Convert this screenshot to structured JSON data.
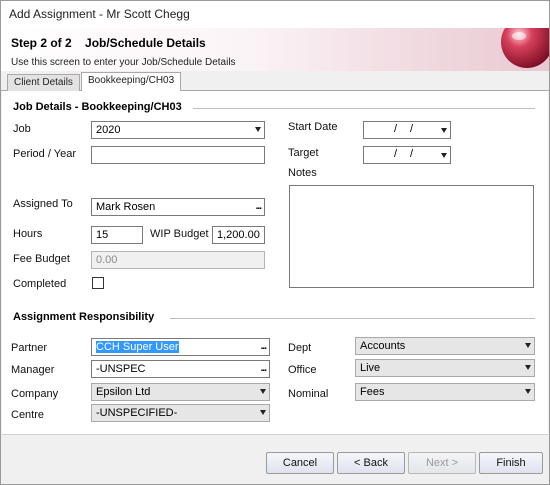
{
  "window": {
    "title": "Add Assignment - Mr Scott Chegg"
  },
  "header": {
    "step": "Step 2 of 2    Job/Schedule Details",
    "subtitle": "Use this screen to enter your Job/Schedule Details"
  },
  "tabs": [
    {
      "label": "Client Details"
    },
    {
      "label": "Bookkeeping/CH03"
    }
  ],
  "job_details": {
    "title": "Job Details - Bookkeeping/CH03",
    "job": {
      "label": "Job",
      "value": "2020"
    },
    "period": {
      "label": "Period / Year",
      "value": ""
    },
    "assigned_to": {
      "label": "Assigned To",
      "value": "Mark Rosen"
    },
    "hours": {
      "label": "Hours",
      "value": "15"
    },
    "wip_budget": {
      "label": "WIP Budget",
      "value": "1,200.00"
    },
    "fee_budget": {
      "label": "Fee Budget",
      "value": "0.00"
    },
    "completed": {
      "label": "Completed",
      "checked": false
    },
    "start_date": {
      "label": "Start Date",
      "sep1": "/",
      "sep2": "/"
    },
    "target": {
      "label": "Target",
      "sep1": "/",
      "sep2": "/"
    },
    "notes": {
      "label": "Notes",
      "value": ""
    }
  },
  "responsibility": {
    "title": "Assignment Responsibility",
    "partner": {
      "label": "Partner",
      "value": "CCH Super User"
    },
    "manager": {
      "label": "Manager",
      "value": "-UNSPEC"
    },
    "company": {
      "label": "Company",
      "value": "Epsilon Ltd"
    },
    "centre": {
      "label": "Centre",
      "value": "-UNSPECIFIED-"
    },
    "dept": {
      "label": "Dept",
      "value": "Accounts"
    },
    "office": {
      "label": "Office",
      "value": "Live"
    },
    "nominal": {
      "label": "Nominal",
      "value": "Fees"
    }
  },
  "buttons": {
    "cancel": "Cancel",
    "back": "< Back",
    "next": "Next >",
    "finish": "Finish",
    "browse": "..."
  },
  "colors": {
    "selection": "#3399ff",
    "header_accent": "#c0304a"
  }
}
